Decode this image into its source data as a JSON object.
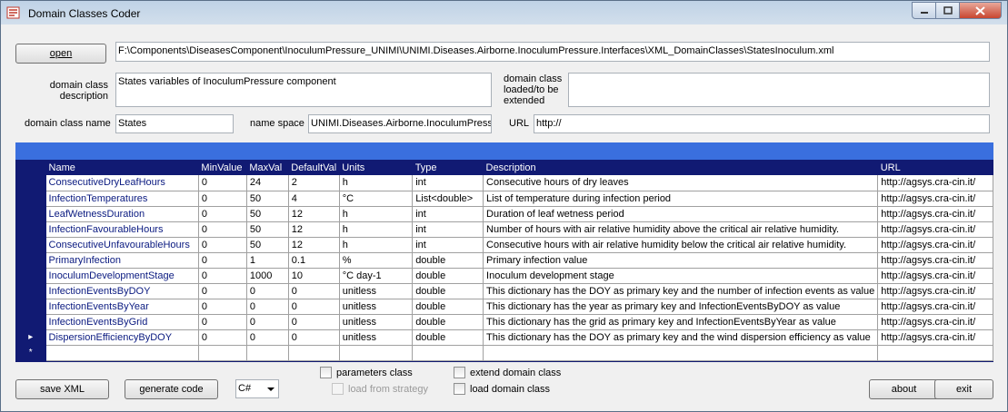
{
  "window": {
    "title": "Domain Classes Coder"
  },
  "toolbar": {
    "open_label": "open",
    "file_path": "F:\\Components\\DiseasesComponent\\InoculumPressure_UNIMI\\UNIMI.Diseases.Airborne.InoculumPressure.Interfaces\\XML_DomainClasses\\StatesInoculum.xml"
  },
  "form": {
    "description_label": "domain class description",
    "description_value": "States variables of InoculumPressure component",
    "loaded_label": "domain class loaded/to be extended",
    "loaded_value": "",
    "name_label": "domain class name",
    "name_value": "States",
    "namespace_label": "name space",
    "namespace_value": "UNIMI.Diseases.Airborne.InoculumPressu",
    "url_label": "URL",
    "url_value": "http://"
  },
  "grid": {
    "columns": [
      "Name",
      "MinValue",
      "MaxVal",
      "DefaultVal",
      "Units",
      "Type",
      "Description",
      "URL"
    ],
    "rows": [
      [
        "ConsecutiveDryLeafHours",
        "0",
        "24",
        "2",
        "h",
        "int",
        "Consecutive hours of dry leaves",
        "http://agsys.cra-cin.it/"
      ],
      [
        "InfectionTemperatures",
        "0",
        "50",
        "4",
        "°C",
        "List<double>",
        "List of temperature during infection period",
        "http://agsys.cra-cin.it/"
      ],
      [
        "LeafWetnessDuration",
        "0",
        "50",
        "12",
        "h",
        "int",
        "Duration of leaf wetness period",
        "http://agsys.cra-cin.it/"
      ],
      [
        "InfectionFavourableHours",
        "0",
        "50",
        "12",
        "h",
        "int",
        "Number of hours with air relative humidity above the critical air relative humidity.",
        "http://agsys.cra-cin.it/"
      ],
      [
        "ConsecutiveUnfavourableHours",
        "0",
        "50",
        "12",
        "h",
        "int",
        "Consecutive hours with air relative humidity below the critical air relative humidity.",
        "http://agsys.cra-cin.it/"
      ],
      [
        "PrimaryInfection",
        "0",
        "1",
        "0.1",
        "%",
        "double",
        "Primary infection value",
        "http://agsys.cra-cin.it/"
      ],
      [
        "InoculumDevelopmentStage",
        "0",
        "1000",
        "10",
        "°C day-1",
        "double",
        "Inoculum development stage",
        "http://agsys.cra-cin.it/"
      ],
      [
        "InfectionEventsByDOY",
        "0",
        "0",
        "0",
        "unitless",
        "double",
        "This dictionary has the DOY as primary key and the number of infection events as value",
        "http://agsys.cra-cin.it/"
      ],
      [
        "InfectionEventsByYear",
        "0",
        "0",
        "0",
        "unitless",
        "double",
        "This dictionary has the year as primary key and InfectionEventsByDOY as value",
        "http://agsys.cra-cin.it/"
      ],
      [
        "InfectionEventsByGrid",
        "0",
        "0",
        "0",
        "unitless",
        "double",
        "This dictionary has the grid as primary key and InfectionEventsByYear as value",
        "http://agsys.cra-cin.it/"
      ],
      [
        "DispersionEfficiencyByDOY",
        "0",
        "0",
        "0",
        "unitless",
        "double",
        "This dictionary has the DOY as primary key and the wind dispersion efficiency as value",
        "http://agsys.cra-cin.it/"
      ]
    ],
    "current_row_marker": "▸",
    "new_row_marker": "*"
  },
  "footer": {
    "save_xml_label": "save XML",
    "generate_code_label": "generate code",
    "language_value": "C#",
    "parameters_class_label": "parameters class",
    "load_from_strategy_label": "load from strategy",
    "extend_domain_class_label": "extend domain class",
    "load_domain_class_label": "load domain class",
    "about_label": "about",
    "exit_label": "exit"
  },
  "colors": {
    "grid_header": "#111a73",
    "blue_bar": "#3a6fde"
  },
  "icons": [
    "app-icon",
    "minimize-icon",
    "maximize-icon",
    "close-icon",
    "chevron-down-icon"
  ]
}
